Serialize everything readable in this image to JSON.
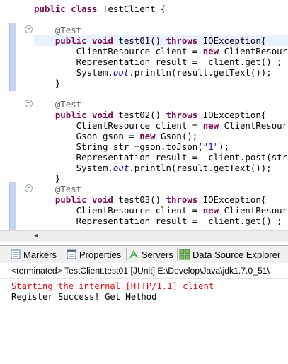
{
  "editor": {
    "lines": [
      {
        "id": "class-decl",
        "parts": [
          {
            "t": "public class ",
            "c": "kw"
          },
          {
            "t": "TestClient {",
            "c": ""
          }
        ]
      },
      {
        "id": "test01-ann",
        "parts": [
          {
            "t": "    @Test",
            "c": "ann"
          }
        ]
      },
      {
        "id": "test01-sig",
        "parts": [
          {
            "t": "    public void ",
            "c": "kw"
          },
          {
            "t": "test01() ",
            "c": ""
          },
          {
            "t": "throws ",
            "c": "kw"
          },
          {
            "t": "IOException{",
            "c": ""
          }
        ]
      },
      {
        "id": "test01-l1",
        "parts": [
          {
            "t": "        ClientResource client = ",
            "c": ""
          },
          {
            "t": "new ",
            "c": "kw"
          },
          {
            "t": "ClientResource(\"",
            "c": ""
          }
        ]
      },
      {
        "id": "test01-l2",
        "parts": [
          {
            "t": "        Representation result =  client.get() ;",
            "c": ""
          }
        ]
      },
      {
        "id": "test01-l3",
        "parts": [
          {
            "t": "        System.",
            "c": ""
          },
          {
            "t": "out",
            "c": "fld"
          },
          {
            "t": ".println(result.getText());",
            "c": ""
          }
        ]
      },
      {
        "id": "test01-end",
        "parts": [
          {
            "t": "    }",
            "c": ""
          }
        ]
      },
      {
        "id": "test02-ann",
        "parts": [
          {
            "t": "    @Test",
            "c": "ann"
          }
        ]
      },
      {
        "id": "test02-sig",
        "parts": [
          {
            "t": "    public void ",
            "c": "kw"
          },
          {
            "t": "test02() ",
            "c": ""
          },
          {
            "t": "throws ",
            "c": "kw"
          },
          {
            "t": "IOException{",
            "c": ""
          }
        ]
      },
      {
        "id": "test02-l1",
        "parts": [
          {
            "t": "        ClientResource client = ",
            "c": ""
          },
          {
            "t": "new ",
            "c": "kw"
          },
          {
            "t": "ClientResource(\"",
            "c": ""
          }
        ]
      },
      {
        "id": "test02-l2",
        "parts": [
          {
            "t": "        Gson gson = ",
            "c": ""
          },
          {
            "t": "new ",
            "c": "kw"
          },
          {
            "t": "Gson();",
            "c": ""
          }
        ]
      },
      {
        "id": "test02-l3",
        "parts": [
          {
            "t": "        String str =gson.toJson(",
            "c": ""
          },
          {
            "t": "\"1\"",
            "c": "str"
          },
          {
            "t": ");",
            "c": ""
          }
        ]
      },
      {
        "id": "test02-l4",
        "parts": [
          {
            "t": "        Representation result =  client.post(str) ;",
            "c": ""
          }
        ]
      },
      {
        "id": "test02-l5",
        "parts": [
          {
            "t": "        System.",
            "c": ""
          },
          {
            "t": "out",
            "c": "fld"
          },
          {
            "t": ".println(result.getText());",
            "c": ""
          }
        ]
      },
      {
        "id": "test02-end",
        "parts": [
          {
            "t": "    }",
            "c": ""
          }
        ]
      },
      {
        "id": "test03-ann",
        "parts": [
          {
            "t": "    @Test",
            "c": "ann"
          }
        ]
      },
      {
        "id": "test03-sig",
        "parts": [
          {
            "t": "    public void ",
            "c": "kw"
          },
          {
            "t": "test03() ",
            "c": ""
          },
          {
            "t": "throws ",
            "c": "kw"
          },
          {
            "t": "IOException{",
            "c": ""
          }
        ]
      },
      {
        "id": "test03-l1",
        "parts": [
          {
            "t": "        ClientResource client = ",
            "c": ""
          },
          {
            "t": "new ",
            "c": "kw"
          },
          {
            "t": "ClientResource(\"",
            "c": ""
          }
        ]
      },
      {
        "id": "test03-l2",
        "parts": [
          {
            "t": "        Representation result =  client.get() ;",
            "c": ""
          }
        ]
      }
    ],
    "scroll_left_icon": "chevron-left-icon"
  },
  "views": {
    "tabs": [
      {
        "label": "Markers",
        "icon": "markers-icon"
      },
      {
        "label": "Properties",
        "icon": "properties-icon"
      },
      {
        "label": "Servers",
        "icon": "servers-icon"
      },
      {
        "label": "Data Source Explorer",
        "icon": "data-source-icon"
      }
    ]
  },
  "console": {
    "header": "<terminated> TestClient.test01 [JUnit] E:\\Develop\\Java\\jdk1.7.0_51\\",
    "lines": [
      {
        "text": "Starting the internal [HTTP/1.1] client",
        "style": "err"
      },
      {
        "text": "Register Success! Get Method",
        "style": ""
      }
    ]
  },
  "colors": {
    "keyword": "#7f0055",
    "annotation": "#646464",
    "string": "#2a00ff",
    "field": "#0000c0",
    "error": "#ff0000",
    "current_line": "#e8f2fe"
  }
}
